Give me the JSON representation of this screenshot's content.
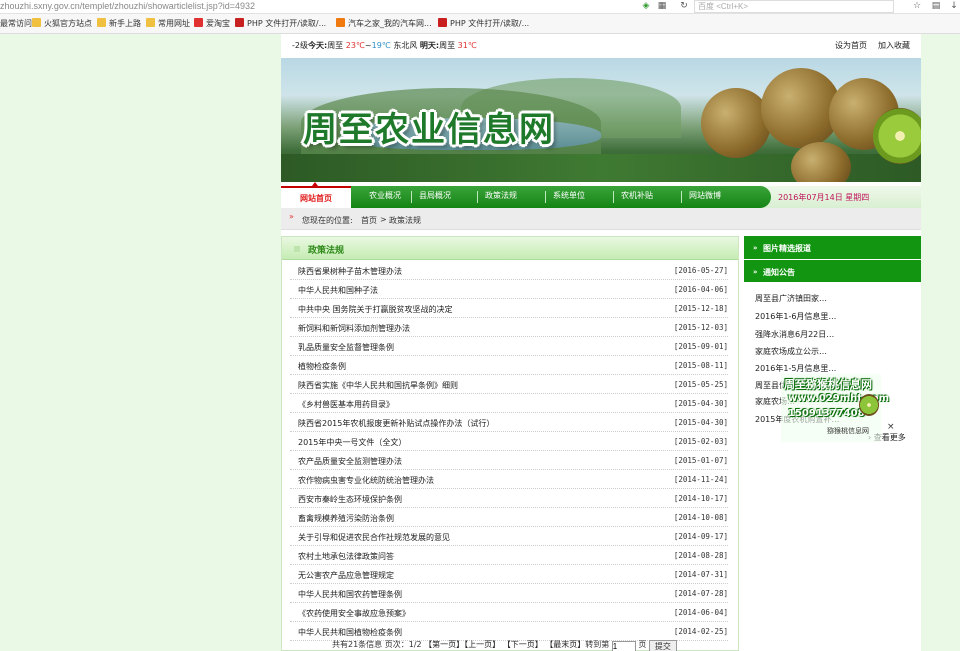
{
  "browser": {
    "url": "zhouzhi.sxny.gov.cn/templet/zhouzhi/showarticlelist.jsp?id=4932",
    "search_placeholder": "百度 <Ctrl+K>",
    "bookmarks": [
      "最常访问",
      "火狐官方站点",
      "新手上路",
      "常用网址",
      "爱淘宝",
      "PHP 文件打开/读取/...",
      "汽车之家_我的汽车网...",
      "PHP 文件打开/读取/..."
    ],
    "icon_colors": {
      "shield": "#2e9b2e",
      "accent_red": "#e03030",
      "folder": "#f0c040"
    }
  },
  "topbar": {
    "level": "-2级",
    "today_label": "今天:",
    "today_place": "周至",
    "today_high": "23℃",
    "tilde": "~",
    "today_low": "19℃",
    "wind": "东北风",
    "tomorrow_label": "明天:",
    "tomorrow_place": "周至",
    "tomorrow_temp": "31℃",
    "set_home": "设为首页",
    "add_fav": "加入收藏"
  },
  "banner": {
    "title": "周至农业信息网"
  },
  "nav": {
    "home": "网站首页",
    "items": [
      "农业概况",
      "县局概况",
      "政策法规",
      "系统单位",
      "农机补贴",
      "网站微博"
    ],
    "date": "2016年07月14日  星期四"
  },
  "breadcrumb": {
    "prefix": "您现在的位置:",
    "home": "首页",
    "sep": ">",
    "current": "政策法规"
  },
  "main": {
    "heading": "政策法规",
    "articles": [
      {
        "title": "陕西省果树种子苗木管理办法",
        "date": "[2016-05-27]"
      },
      {
        "title": "中华人民共和国种子法",
        "date": "[2016-04-06]"
      },
      {
        "title": "中共中央 国务院关于打赢脱贫攻坚战的决定",
        "date": "[2015-12-18]"
      },
      {
        "title": "新饲料和新饲料添加剂管理办法",
        "date": "[2015-12-03]"
      },
      {
        "title": "乳品质量安全监督管理条例",
        "date": "[2015-09-01]"
      },
      {
        "title": "植物检疫条例",
        "date": "[2015-08-11]"
      },
      {
        "title": "陕西省实施《中华人民共和国抗旱条例》细则",
        "date": "[2015-05-25]"
      },
      {
        "title": "《乡村兽医基本用药目录》",
        "date": "[2015-04-30]"
      },
      {
        "title": "陕西省2015年农机报废更新补贴试点操作办法（试行）",
        "date": "[2015-04-30]"
      },
      {
        "title": "2015年中央一号文件（全文）",
        "date": "[2015-02-03]"
      },
      {
        "title": "农产品质量安全监测管理办法",
        "date": "[2015-01-07]"
      },
      {
        "title": "农作物病虫害专业化统防统治管理办法",
        "date": "[2014-11-24]"
      },
      {
        "title": "西安市秦岭生态环境保护条例",
        "date": "[2014-10-17]"
      },
      {
        "title": "畜禽规模养殖污染防治条例",
        "date": "[2014-10-08]"
      },
      {
        "title": "关于引导和促进农民合作社规范发展的意见",
        "date": "[2014-09-17]"
      },
      {
        "title": "农村土地承包法律政策问答",
        "date": "[2014-08-28]"
      },
      {
        "title": "无公害农产品应急管理规定",
        "date": "[2014-07-31]"
      },
      {
        "title": "中华人民共和国农药管理条例",
        "date": "[2014-07-28]"
      },
      {
        "title": "《农药使用安全事故应急预案》",
        "date": "[2014-06-04]"
      },
      {
        "title": "中华人民共和国植物检疫条例",
        "date": "[2014-02-25]"
      }
    ],
    "pager": {
      "total": "共有21条信息",
      "pages": "页次：1/2",
      "first": "【第一页】",
      "prev": "【上一页】",
      "next": "【下一页】",
      "last": "【最末页】",
      "goto": "转到第",
      "page_value": "1",
      "page_unit": "页",
      "submit": "提交"
    }
  },
  "sidebar": {
    "photo_heading": "图片精选报道",
    "notice_heading": "通知公告",
    "notices": [
      "周至县广济镇田家…",
      "2016年1-6月信息里…",
      "强降水消息6月22日…",
      "家庭农场成立公示…",
      "2016年1-5月信息里…",
      "周至县优…",
      "家庭农场…",
      "2015年度农机购置补…"
    ],
    "more": "查看更多"
  },
  "ad": {
    "line1": "周至猕猴桃信息网",
    "line2": "www.029mht.com",
    "line3": "15091377408",
    "caption": "猕猴桃信息网",
    "close": "×"
  }
}
